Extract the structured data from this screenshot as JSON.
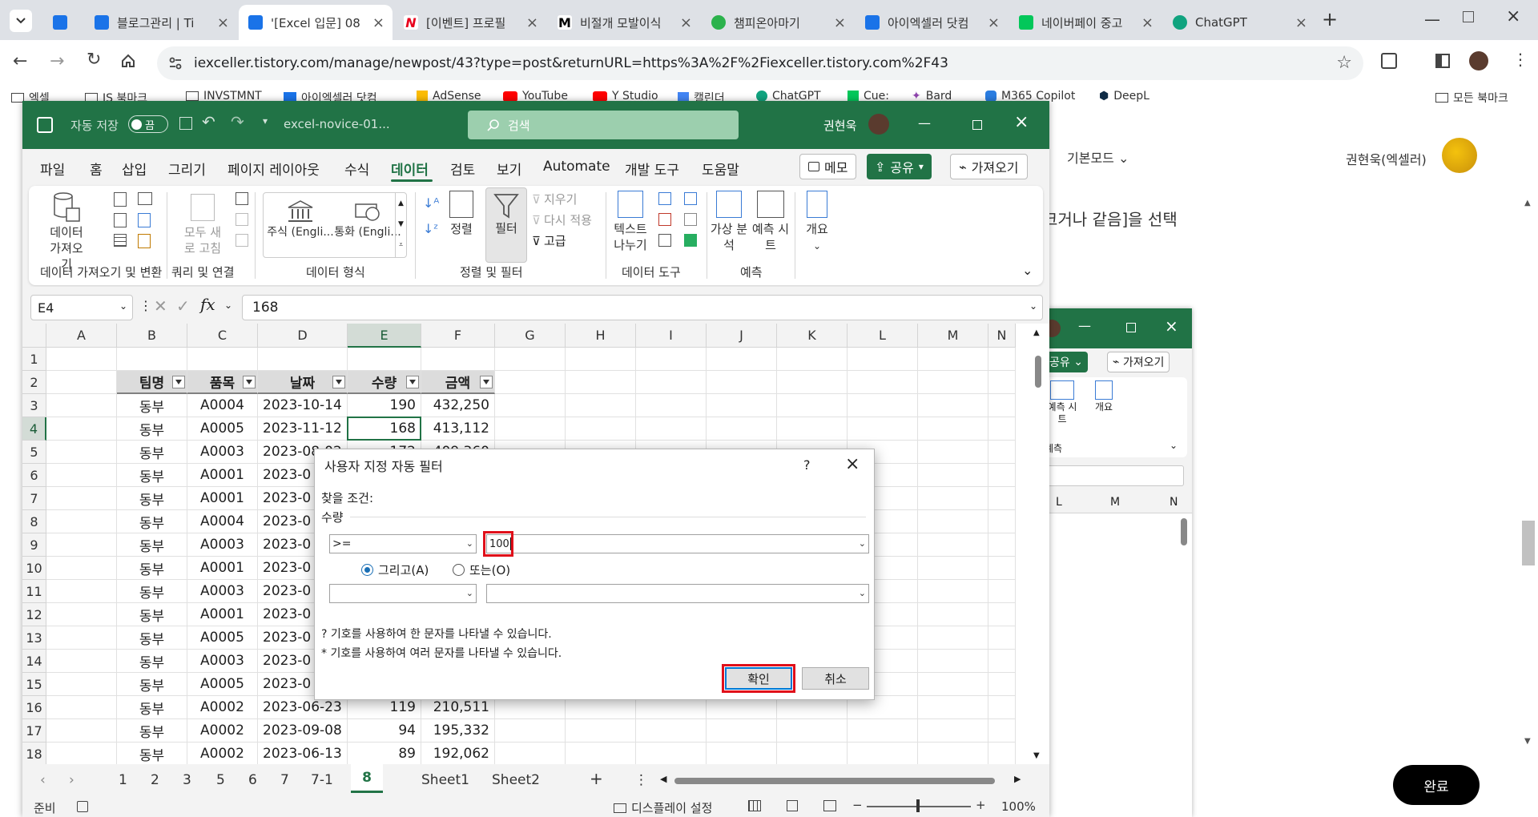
{
  "browser": {
    "tabs": [
      {
        "label": "",
        "fav_color": "#1a73e8"
      },
      {
        "label": "블로그관리 | Ti",
        "fav_color": "#1a73e8"
      },
      {
        "label": "'[Excel 입문] 08",
        "fav_color": "#1a73e8"
      },
      {
        "label": "[이벤트] 프로필",
        "fav_color": "#e8001c"
      },
      {
        "label": "비절개 모발이식",
        "fav_color": "#000000"
      },
      {
        "label": "챔피온아마기",
        "fav_color": "#2bb24c"
      },
      {
        "label": "아이엑셀러 닷컴",
        "fav_color": "#1a73e8"
      },
      {
        "label": "네이버페이 중고",
        "fav_color": "#03c75a"
      },
      {
        "label": "ChatGPT",
        "fav_color": "#10a37f"
      }
    ],
    "url": "iexceller.tistory.com/manage/newpost/43?type=post&returnURL=https%3A%2F%2Fiexceller.tistory.com%2F43",
    "bookmarks": [
      "엑셀",
      "JS 북마크",
      "INVSTMNT",
      "아이엑셀러 닷컴",
      "AdSense",
      "YouTube",
      "Y Studio",
      "캘린더",
      "ChatGPT",
      "Cue:",
      "Bard",
      "M365 Copilot",
      "DeepL"
    ],
    "all_bookmarks": "모든 북마크"
  },
  "page": {
    "mode": "기본모드",
    "user": "권현욱(엑셀러)",
    "body_text": "크거나 같음]을 선택",
    "done_button": "완료"
  },
  "excel": {
    "autosave_label": "자동 저장",
    "autosave_state": "끔",
    "filename": "excel-novice-01...",
    "search_placeholder": "검색",
    "user": "권현욱",
    "ribbon_tabs": [
      "파일",
      "홈",
      "삽입",
      "그리기",
      "페이지 레이아웃",
      "수식",
      "데이터",
      "검토",
      "보기",
      "Automate",
      "개발 도구",
      "도움말"
    ],
    "active_tab": "데이터",
    "memo_btn": "메모",
    "share_btn": "공유",
    "import_btn": "가져오기",
    "groups": {
      "get_data": "데이터 가져오기 및 변환",
      "queries": "쿼리 및 연결",
      "data_types": "데이터 형식",
      "sort_filter": "정렬 및 필터",
      "data_tools": "데이터 도구",
      "forecast": "예측"
    },
    "buttons": {
      "get_data": "데이터 가져오기",
      "refresh_all": "모두 새로 고침",
      "stocks": "주식 (Engli...",
      "currency": "통화 (Engli...",
      "sort": "정렬",
      "filter": "필터",
      "clear": "지우기",
      "reapply": "다시 적용",
      "advanced": "고급",
      "text_to_columns": "텍스트 나누기",
      "what_if": "가상 분석",
      "forecast_sheet": "예측 시트",
      "outline": "개요"
    },
    "name_box": "E4",
    "formula": "168",
    "columns": [
      "A",
      "B",
      "C",
      "D",
      "E",
      "F",
      "G",
      "H",
      "I",
      "J",
      "K",
      "L",
      "M",
      "N"
    ],
    "rows": [
      "1",
      "2",
      "3",
      "4",
      "5",
      "6",
      "7",
      "8",
      "9",
      "10",
      "11",
      "12",
      "13",
      "14",
      "15",
      "16",
      "17",
      "18"
    ],
    "headers": [
      "팀명",
      "품목",
      "날짜",
      "수량",
      "금액"
    ],
    "data": [
      [
        "동부",
        "A0004",
        "2023-10-14",
        "190",
        "432,250"
      ],
      [
        "동부",
        "A0005",
        "2023-11-12",
        "168",
        "413,112"
      ],
      [
        "동부",
        "A0003",
        "2023-08-02",
        "172",
        "409,360"
      ],
      [
        "동부",
        "A0001",
        "2023-0",
        "",
        ""
      ],
      [
        "동부",
        "A0001",
        "2023-0",
        "",
        ""
      ],
      [
        "동부",
        "A0004",
        "2023-0",
        "",
        ""
      ],
      [
        "동부",
        "A0003",
        "2023-0",
        "",
        ""
      ],
      [
        "동부",
        "A0001",
        "2023-0",
        "",
        ""
      ],
      [
        "동부",
        "A0003",
        "2023-0",
        "",
        ""
      ],
      [
        "동부",
        "A0001",
        "2023-0",
        "",
        ""
      ],
      [
        "동부",
        "A0005",
        "2023-0",
        "",
        ""
      ],
      [
        "동부",
        "A0003",
        "2023-0",
        "",
        ""
      ],
      [
        "동부",
        "A0005",
        "2023-0",
        "",
        ""
      ],
      [
        "동부",
        "A0002",
        "2023-06-23",
        "119",
        "210,511"
      ],
      [
        "동부",
        "A0002",
        "2023-09-08",
        "94",
        "195,332"
      ],
      [
        "동부",
        "A0002",
        "2023-06-13",
        "89",
        "192,062"
      ]
    ],
    "sheet_tabs": [
      "1",
      "2",
      "3",
      "5",
      "6",
      "7",
      "7-1",
      "8",
      "Sheet1",
      "Sheet2"
    ],
    "active_sheet": "8",
    "status": "준비",
    "display_settings": "디스플레이 설정",
    "zoom": "100%"
  },
  "dialog": {
    "title": "사용자 지정 자동 필터",
    "help": "?",
    "criteria_label": "찾을 조건:",
    "field_label": "수량",
    "operator1": ">=",
    "value1": "100",
    "and_label": "그리고(A)",
    "or_label": "또는(O)",
    "operator2": "",
    "value2": "",
    "hint1": "? 기호를 사용하여 한 문자를 나타낼 수 있습니다.",
    "hint2": "* 기호를 사용하여 여러 문자를 나타낼 수 있습니다.",
    "ok": "확인",
    "cancel": "취소"
  },
  "excel2": {
    "share_btn": "공유",
    "import_btn": "가져오기",
    "forecast_sheet": "예측 시트",
    "outline": "개요",
    "group": "예측",
    "col_l": "L",
    "col_m": "M",
    "col_n": "N"
  },
  "colors": {
    "excel_green": "#217346",
    "highlight_red": "#e0101a"
  }
}
